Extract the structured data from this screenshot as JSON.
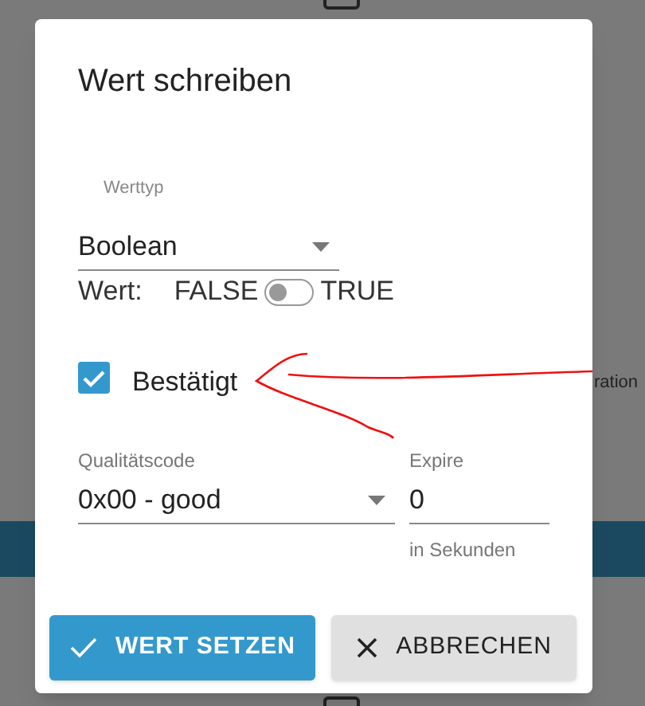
{
  "background": {
    "side_text": "ration"
  },
  "dialog": {
    "title": "Wert schreiben",
    "value_type": {
      "label": "Werttyp",
      "value": "Boolean"
    },
    "value_switch": {
      "label": "Wert:",
      "off_label": "FALSE",
      "on_label": "TRUE",
      "on": false
    },
    "confirmed": {
      "label": "Bestätigt",
      "checked": true
    },
    "quality": {
      "label": "Qualitätscode",
      "value": "0x00 - good"
    },
    "expire": {
      "label": "Expire",
      "value": "0",
      "hint": "in Sekunden"
    },
    "buttons": [
      {
        "kind": "primary",
        "label": "WERT SETZEN"
      },
      {
        "kind": "secondary",
        "label": "ABBRECHEN"
      }
    ]
  }
}
